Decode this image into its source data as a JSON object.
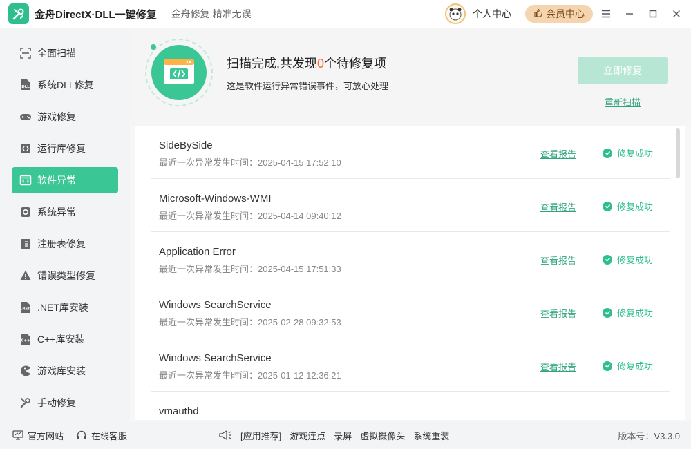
{
  "header": {
    "app_title": "金舟DirectX·DLL一键修复",
    "slogan": "金舟修复 精准无误",
    "user_center": "个人中心",
    "vip_center": "会员中心"
  },
  "sidebar": {
    "items": [
      {
        "label": "全面扫描",
        "icon": "scan-icon"
      },
      {
        "label": "系统DLL修复",
        "icon": "dll-icon"
      },
      {
        "label": "游戏修复",
        "icon": "gamepad-icon"
      },
      {
        "label": "运行库修复",
        "icon": "runtime-icon"
      },
      {
        "label": "软件异常",
        "icon": "code-window-icon",
        "active": true
      },
      {
        "label": "系统异常",
        "icon": "gear-icon"
      },
      {
        "label": "注册表修复",
        "icon": "list-icon"
      },
      {
        "label": "错误类型修复",
        "icon": "warning-icon"
      },
      {
        "label": ".NET库安装",
        "icon": "dotnet-icon"
      },
      {
        "label": "C++库安装",
        "icon": "cpp-icon"
      },
      {
        "label": "游戏库安装",
        "icon": "pacman-icon"
      },
      {
        "label": "手动修复",
        "icon": "tools-icon"
      }
    ]
  },
  "summary": {
    "title_prefix": "扫描完成,共发现",
    "count": "0",
    "title_suffix": "个待修复项",
    "subtitle": "这是软件运行异常错误事件，可放心处理",
    "fix_button": "立即修复",
    "rescan": "重新扫描"
  },
  "list": {
    "report_label": "查看报告",
    "status_label": "修复成功",
    "time_prefix": "最近一次异常发生时间：",
    "rows": [
      {
        "name": "SideBySide",
        "time": "2025-04-15 17:52:10"
      },
      {
        "name": "Microsoft-Windows-WMI",
        "time": "2025-04-14 09:40:12"
      },
      {
        "name": "Application Error",
        "time": "2025-04-15 17:51:33"
      },
      {
        "name": "Windows SearchService",
        "time": "2025-02-28 09:32:53"
      },
      {
        "name": "Windows SearchService",
        "time": "2025-01-12 12:36:21"
      },
      {
        "name": "vmauthd",
        "time": ""
      }
    ]
  },
  "footer": {
    "official_site": "官方网站",
    "online_service": "在线客服",
    "app_recommend": "[应用推荐]",
    "links": [
      "游戏连点",
      "录屏",
      "虚拟摄像头",
      "系统重装"
    ],
    "version": "版本号：V3.3.0"
  },
  "colors": {
    "accent": "#3bc795",
    "count_color": "#ff6b2c",
    "vip_bg": "#f5d5b0"
  }
}
